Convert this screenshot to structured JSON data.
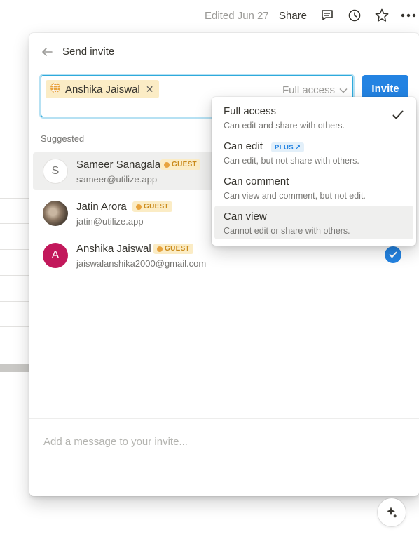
{
  "topbar": {
    "edited": "Edited Jun 27",
    "share": "Share"
  },
  "panel": {
    "title": "Send invite",
    "chip_name": "Anshika Jaiswal",
    "access_value": "Full access",
    "invite_label": "Invite",
    "suggested_label": "Suggested",
    "message_placeholder": "Add a message to your invite..."
  },
  "users": [
    {
      "initial": "S",
      "name": "Sameer Sanagala",
      "badge": "GUEST",
      "email": "sameer@utilize.app"
    },
    {
      "initial": "",
      "name": "Jatin Arora",
      "badge": "GUEST",
      "email": "jatin@utilize.app"
    },
    {
      "initial": "A",
      "name": "Anshika Jaiswal",
      "badge": "GUEST",
      "email": "jaiswalanshika2000@gmail.com"
    }
  ],
  "access_options": [
    {
      "title": "Full access",
      "desc": "Can edit and share with others."
    },
    {
      "title": "Can edit",
      "desc": "Can edit, but not share with others.",
      "badge": "PLUS"
    },
    {
      "title": "Can comment",
      "desc": "Can view and comment, but not edit."
    },
    {
      "title": "Can view",
      "desc": "Cannot edit or share with others."
    }
  ],
  "colors": {
    "accent": "#2383e2",
    "guest_badge_bg": "#fbecc5",
    "avatar_a": "#c2185b"
  },
  "icons": {
    "comment": "comment-icon",
    "history": "clock-icon",
    "favorite": "star-icon",
    "more": "more-icon",
    "fab": "sparkle-icon"
  }
}
